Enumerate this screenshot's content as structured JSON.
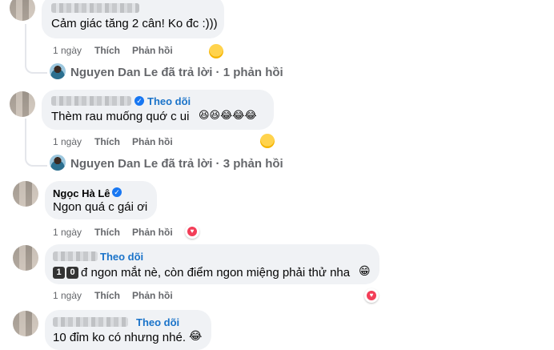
{
  "actions": {
    "like": "Thích",
    "reply": "Phản hồi"
  },
  "comments": [
    {
      "id": "c1",
      "text": "Cảm giác tăng 2 cân! Ko đc :)))",
      "time": "1 ngày",
      "reaction": "laugh",
      "replies_summary": {
        "user": "Nguyen Dan Le",
        "text": "Nguyen Dan Le đã trả lời · 1 phản hồi"
      }
    },
    {
      "id": "c2",
      "follow": "Theo dõi",
      "text": "Thèm rau muống quớ c ui",
      "text_emojis": "😆😆😂😂😂",
      "time": "1 ngày",
      "reaction": "tongue",
      "replies_summary": {
        "user": "Nguyen Dan Le",
        "text": "Nguyen Dan Le đã trả lời · 3 phản hồi"
      }
    },
    {
      "id": "c3",
      "name": "Ngọc Hà Lê",
      "text": "Ngon quá c gái ơi",
      "time": "1 ngày",
      "reaction": "heart"
    },
    {
      "id": "c4",
      "follow": "Theo dõi",
      "keycap_1": "1",
      "keycap_2": "0",
      "text": "đ ngon mắt nè, còn điểm ngon miệng phải thử nha",
      "text_emoji": "😁",
      "time": "1 ngày",
      "reaction": "heart"
    },
    {
      "id": "c5",
      "follow": "Theo dõi",
      "text": "10 đỉm ko có nhưng nhé.",
      "text_emoji": "😂"
    }
  ]
}
